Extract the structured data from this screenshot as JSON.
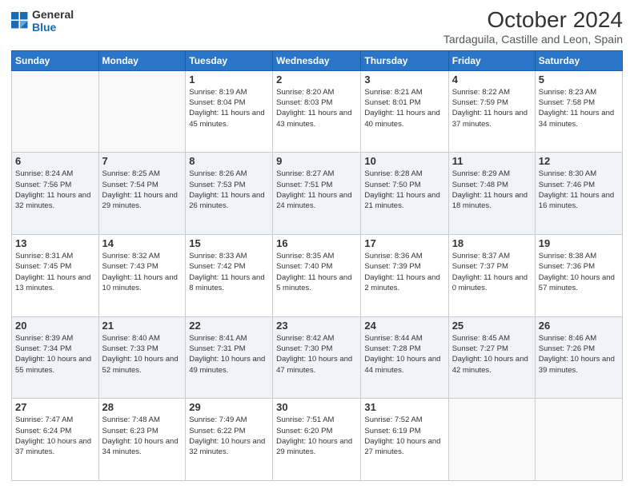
{
  "logo": {
    "line1": "General",
    "line2": "Blue"
  },
  "title": "October 2024",
  "subtitle": "Tardaguila, Castille and Leon, Spain",
  "weekdays": [
    "Sunday",
    "Monday",
    "Tuesday",
    "Wednesday",
    "Thursday",
    "Friday",
    "Saturday"
  ],
  "weeks": [
    [
      {
        "day": "",
        "detail": ""
      },
      {
        "day": "",
        "detail": ""
      },
      {
        "day": "1",
        "detail": "Sunrise: 8:19 AM\nSunset: 8:04 PM\nDaylight: 11 hours and 45 minutes."
      },
      {
        "day": "2",
        "detail": "Sunrise: 8:20 AM\nSunset: 8:03 PM\nDaylight: 11 hours and 43 minutes."
      },
      {
        "day": "3",
        "detail": "Sunrise: 8:21 AM\nSunset: 8:01 PM\nDaylight: 11 hours and 40 minutes."
      },
      {
        "day": "4",
        "detail": "Sunrise: 8:22 AM\nSunset: 7:59 PM\nDaylight: 11 hours and 37 minutes."
      },
      {
        "day": "5",
        "detail": "Sunrise: 8:23 AM\nSunset: 7:58 PM\nDaylight: 11 hours and 34 minutes."
      }
    ],
    [
      {
        "day": "6",
        "detail": "Sunrise: 8:24 AM\nSunset: 7:56 PM\nDaylight: 11 hours and 32 minutes."
      },
      {
        "day": "7",
        "detail": "Sunrise: 8:25 AM\nSunset: 7:54 PM\nDaylight: 11 hours and 29 minutes."
      },
      {
        "day": "8",
        "detail": "Sunrise: 8:26 AM\nSunset: 7:53 PM\nDaylight: 11 hours and 26 minutes."
      },
      {
        "day": "9",
        "detail": "Sunrise: 8:27 AM\nSunset: 7:51 PM\nDaylight: 11 hours and 24 minutes."
      },
      {
        "day": "10",
        "detail": "Sunrise: 8:28 AM\nSunset: 7:50 PM\nDaylight: 11 hours and 21 minutes."
      },
      {
        "day": "11",
        "detail": "Sunrise: 8:29 AM\nSunset: 7:48 PM\nDaylight: 11 hours and 18 minutes."
      },
      {
        "day": "12",
        "detail": "Sunrise: 8:30 AM\nSunset: 7:46 PM\nDaylight: 11 hours and 16 minutes."
      }
    ],
    [
      {
        "day": "13",
        "detail": "Sunrise: 8:31 AM\nSunset: 7:45 PM\nDaylight: 11 hours and 13 minutes."
      },
      {
        "day": "14",
        "detail": "Sunrise: 8:32 AM\nSunset: 7:43 PM\nDaylight: 11 hours and 10 minutes."
      },
      {
        "day": "15",
        "detail": "Sunrise: 8:33 AM\nSunset: 7:42 PM\nDaylight: 11 hours and 8 minutes."
      },
      {
        "day": "16",
        "detail": "Sunrise: 8:35 AM\nSunset: 7:40 PM\nDaylight: 11 hours and 5 minutes."
      },
      {
        "day": "17",
        "detail": "Sunrise: 8:36 AM\nSunset: 7:39 PM\nDaylight: 11 hours and 2 minutes."
      },
      {
        "day": "18",
        "detail": "Sunrise: 8:37 AM\nSunset: 7:37 PM\nDaylight: 11 hours and 0 minutes."
      },
      {
        "day": "19",
        "detail": "Sunrise: 8:38 AM\nSunset: 7:36 PM\nDaylight: 10 hours and 57 minutes."
      }
    ],
    [
      {
        "day": "20",
        "detail": "Sunrise: 8:39 AM\nSunset: 7:34 PM\nDaylight: 10 hours and 55 minutes."
      },
      {
        "day": "21",
        "detail": "Sunrise: 8:40 AM\nSunset: 7:33 PM\nDaylight: 10 hours and 52 minutes."
      },
      {
        "day": "22",
        "detail": "Sunrise: 8:41 AM\nSunset: 7:31 PM\nDaylight: 10 hours and 49 minutes."
      },
      {
        "day": "23",
        "detail": "Sunrise: 8:42 AM\nSunset: 7:30 PM\nDaylight: 10 hours and 47 minutes."
      },
      {
        "day": "24",
        "detail": "Sunrise: 8:44 AM\nSunset: 7:28 PM\nDaylight: 10 hours and 44 minutes."
      },
      {
        "day": "25",
        "detail": "Sunrise: 8:45 AM\nSunset: 7:27 PM\nDaylight: 10 hours and 42 minutes."
      },
      {
        "day": "26",
        "detail": "Sunrise: 8:46 AM\nSunset: 7:26 PM\nDaylight: 10 hours and 39 minutes."
      }
    ],
    [
      {
        "day": "27",
        "detail": "Sunrise: 7:47 AM\nSunset: 6:24 PM\nDaylight: 10 hours and 37 minutes."
      },
      {
        "day": "28",
        "detail": "Sunrise: 7:48 AM\nSunset: 6:23 PM\nDaylight: 10 hours and 34 minutes."
      },
      {
        "day": "29",
        "detail": "Sunrise: 7:49 AM\nSunset: 6:22 PM\nDaylight: 10 hours and 32 minutes."
      },
      {
        "day": "30",
        "detail": "Sunrise: 7:51 AM\nSunset: 6:20 PM\nDaylight: 10 hours and 29 minutes."
      },
      {
        "day": "31",
        "detail": "Sunrise: 7:52 AM\nSunset: 6:19 PM\nDaylight: 10 hours and 27 minutes."
      },
      {
        "day": "",
        "detail": ""
      },
      {
        "day": "",
        "detail": ""
      }
    ]
  ],
  "row_stripes": [
    false,
    true,
    false,
    true,
    false
  ]
}
